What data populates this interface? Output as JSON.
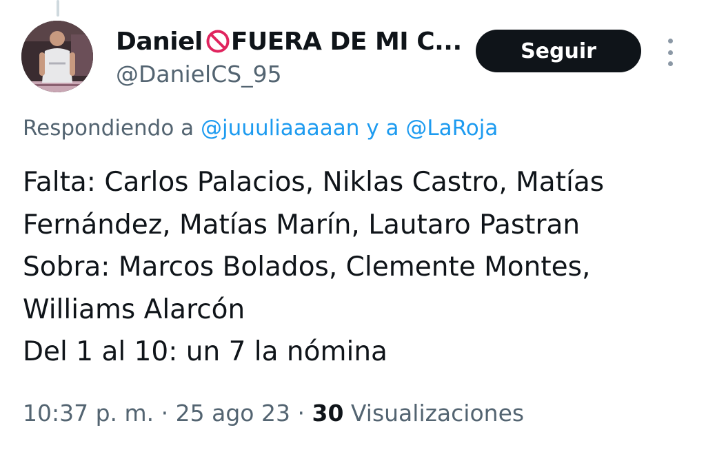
{
  "header": {
    "display_name_start": "Daniel",
    "display_name_rest": "FUERA DE MI C...",
    "handle": "@DanielCS_95",
    "follow_label": "Seguir"
  },
  "reply_context": {
    "prefix": "Respondiendo a",
    "mention_1": "@juuuliaaaaan",
    "joiner": "y a",
    "mention_2": "@LaRoja"
  },
  "tweet": {
    "lines": [
      "Falta: Carlos Palacios, Niklas Castro, Matías",
      "Fernández, Matías Marín, Lautaro Pastran",
      "Sobra: Marcos Bolados, Clemente Montes,",
      "Williams Alarcón",
      "Del 1 al 10: un 7 la nómina"
    ]
  },
  "meta": {
    "time": "10:37 p. m.",
    "date": "25 ago 23",
    "separator": "·",
    "views_count": "30",
    "views_label": "Visualizaciones"
  },
  "colors": {
    "link": "#1d9bf0",
    "secondary_text": "#536471",
    "primary_text": "#0f1419",
    "follow_button_bg": "#0f1419",
    "no_entry_red": "#e0245e"
  },
  "icons": {
    "no_entry": "no-entry-icon",
    "more": "more-icon"
  }
}
